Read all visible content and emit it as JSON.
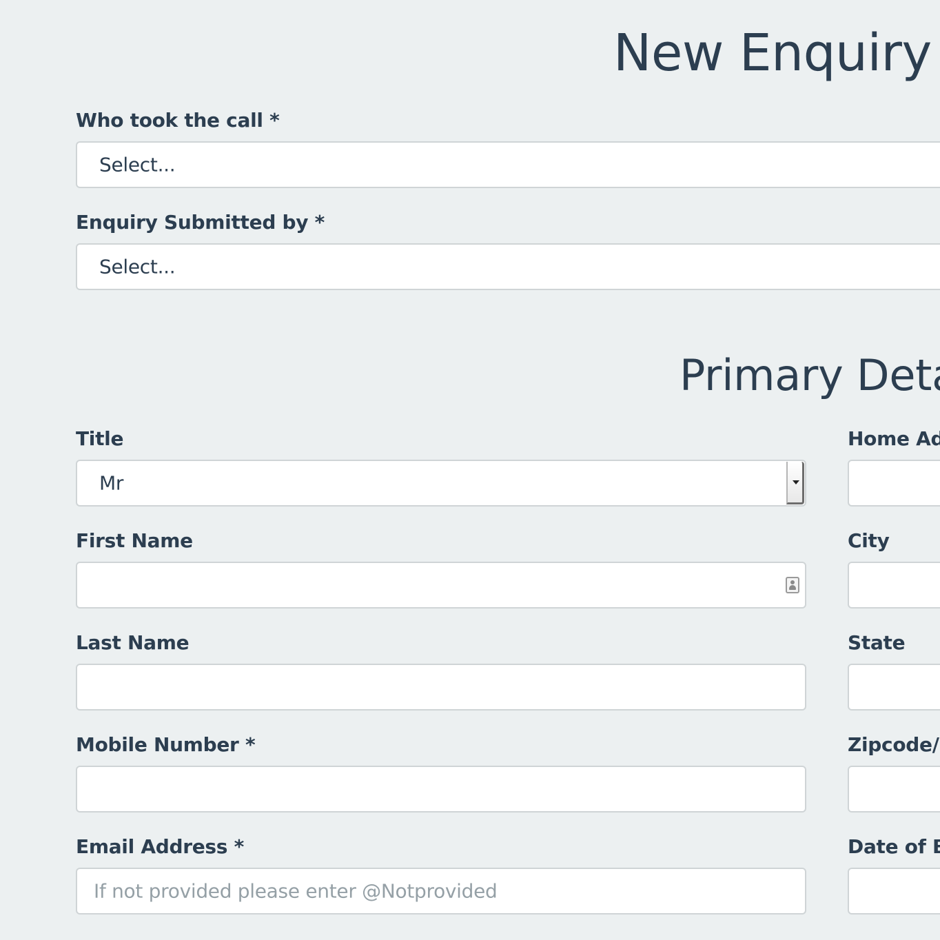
{
  "form": {
    "heading": "New Enquiry F",
    "who_took_call_label": "Who took the call *",
    "who_took_call_value": "Select...",
    "submitted_by_label": "Enquiry Submitted by *",
    "submitted_by_value": "Select..."
  },
  "primary": {
    "heading": "Primary Detai",
    "title_label": "Title",
    "title_value": "Mr",
    "first_name_label": "First Name",
    "last_name_label": "Last Name",
    "mobile_label": "Mobile Number *",
    "email_label": "Email Address *",
    "email_placeholder": "If not provided please enter @Notprovided",
    "home_address_label": "Home Adc",
    "city_label": "City",
    "state_label": "State",
    "zipcode_label": "Zipcode/P",
    "dob_label": "Date of Bi"
  },
  "colors": {
    "background": "#ecf0f1",
    "text": "#2c3e50",
    "field_border": "#cfd4d6",
    "placeholder": "#95a0a6"
  }
}
